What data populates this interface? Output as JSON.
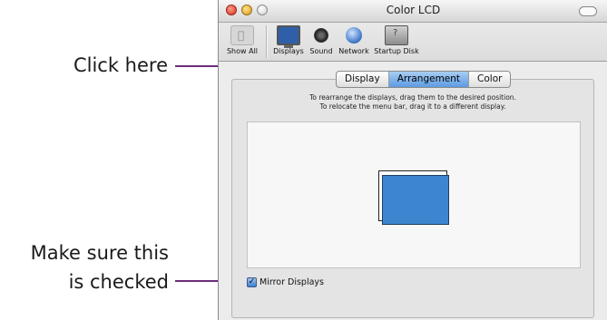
{
  "callouts": {
    "click_here": "Click here",
    "mirror_line1": "Make sure this",
    "mirror_line2": "is checked"
  },
  "window": {
    "title": "Color LCD"
  },
  "toolbar": {
    "items": [
      {
        "label": "Show All",
        "icon": "apple-icon"
      },
      {
        "label": "Displays",
        "icon": "display-icon"
      },
      {
        "label": "Sound",
        "icon": "speaker-icon"
      },
      {
        "label": "Network",
        "icon": "globe-icon"
      },
      {
        "label": "Startup Disk",
        "icon": "disk-icon"
      }
    ]
  },
  "tabs": [
    {
      "label": "Display",
      "selected": false
    },
    {
      "label": "Arrangement",
      "selected": true
    },
    {
      "label": "Color",
      "selected": false
    }
  ],
  "arrangement": {
    "instruction_line1": "To rearrange the displays, drag them to the desired position.",
    "instruction_line2": "To relocate the menu bar, drag it to a different display."
  },
  "mirror": {
    "label": "Mirror Displays",
    "checked": true,
    "check_glyph": "✓"
  },
  "colors": {
    "callout_line": "#6b2d7a",
    "selected_tab": "#5d9be3",
    "display_blue": "#3d85cf"
  }
}
